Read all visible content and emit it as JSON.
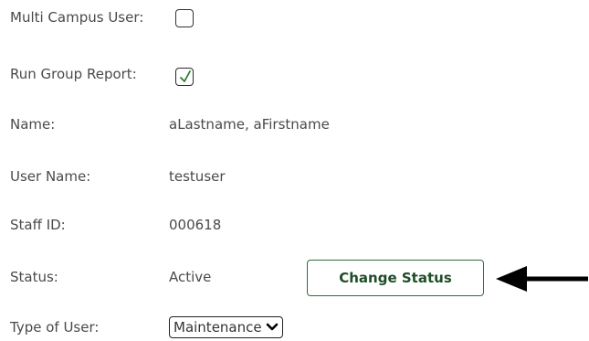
{
  "form": {
    "multi_campus": {
      "label": "Multi Campus User:",
      "checked": false
    },
    "run_group_report": {
      "label": "Run Group Report:",
      "checked": true
    },
    "name": {
      "label": "Name:",
      "value": "aLastname, aFirstname"
    },
    "user_name": {
      "label": "User Name:",
      "value": "testuser"
    },
    "staff_id": {
      "label": "Staff ID:",
      "value": "000618"
    },
    "status": {
      "label": "Status:",
      "value": "Active",
      "button_label": "Change Status"
    },
    "type_of_user": {
      "label": "Type of User:",
      "selected": "Maintenance"
    }
  },
  "colors": {
    "button_border": "#2f6e3a",
    "button_text": "#1f4d28",
    "checkmark": "#2e7d32",
    "arrow": "#000000"
  },
  "icons": {
    "checkmark": "checkmark-icon",
    "select_chevron": "chevron-down-icon",
    "pointer": "left-arrow-icon"
  }
}
